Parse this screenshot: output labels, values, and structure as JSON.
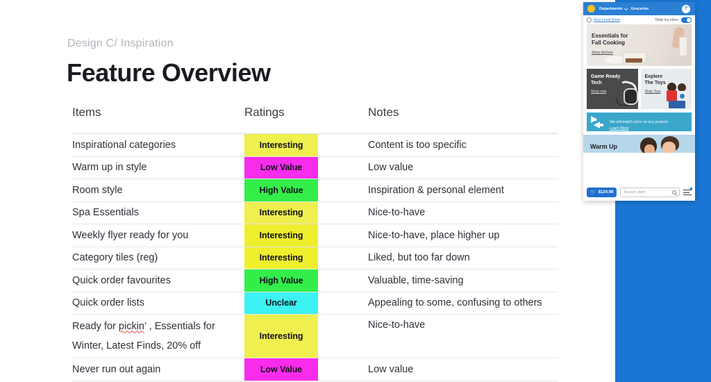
{
  "slide": {
    "eyebrow": "Design C/ Inspiration",
    "title": "Feature Overview"
  },
  "table": {
    "headers": {
      "items": "Items",
      "ratings": "Ratings",
      "notes": "Notes"
    },
    "rows": [
      {
        "item_lines": [
          "Inspirational categories"
        ],
        "rating": "Interesting",
        "rating_color": "#EFEF4F",
        "note": "Content is too specific"
      },
      {
        "item_lines": [
          "Warm up in style"
        ],
        "rating": "Low Value",
        "rating_color": "#F92CEC",
        "note": "Low value"
      },
      {
        "item_lines": [
          "Room style"
        ],
        "rating": "High Value",
        "rating_color": "#33EE4A",
        "note": "Inspiration & personal element"
      },
      {
        "item_lines": [
          "Spa Essentials"
        ],
        "rating": "Interesting",
        "rating_color": "#EFEF4F",
        "note": "Nice-to-have"
      },
      {
        "item_lines": [
          "Weekly flyer ready for you"
        ],
        "rating": "Interesting",
        "rating_color": "#EFEF2E",
        "note": "Nice-to-have, place higher up"
      },
      {
        "item_lines": [
          "Category tiles (reg)"
        ],
        "rating": "Interesting",
        "rating_color": "#EFEF2E",
        "note": "Liked, but too far down"
      },
      {
        "item_lines": [
          "Quick order favourites"
        ],
        "rating": "High Value",
        "rating_color": "#33EE4A",
        "note": "Valuable, time-saving"
      },
      {
        "item_lines": [
          "Quick order lists"
        ],
        "rating": "Unclear",
        "rating_color": "#3DF2F2",
        "note": "Appealing to some, confusing to others"
      },
      {
        "item_lines": [
          "Ready for pickin’ , Essentials for",
          "Winter, Latest Finds, 20% off"
        ],
        "misspelled_word": "pickin",
        "rating": "Interesting",
        "rating_color": "#EFEF4F",
        "note": "Nice-to-have",
        "tall": true
      },
      {
        "item_lines": [
          "Never run out again"
        ],
        "rating": "Low Value",
        "rating_color": "#F92CEC",
        "note": "Low value"
      }
    ]
  },
  "mockup": {
    "topbar": {
      "logo": "yellow-circle-logo",
      "departments": "Departments",
      "groceries": "Groceries",
      "help": "?"
    },
    "storebar": {
      "store_link": "Your Local Store",
      "shop_my_store_label": "Shop my store:",
      "toggle_state": "on"
    },
    "hero": {
      "title_line1": "Essentials for",
      "title_line2": "Fall Cooking",
      "link": "Shop Kitchen"
    },
    "tiles": [
      {
        "title_line1": "Game Ready",
        "title_line2": "Tech",
        "link": "Shop now"
      },
      {
        "title_line1": "Explore",
        "title_line2": "The Toys",
        "link": "Shop Toys"
      }
    ],
    "promo": {
      "text": "We will match price on any product.",
      "link": "Learn More"
    },
    "warm": {
      "title": "Warm Up"
    },
    "bottom": {
      "cart_amount": "$124.98",
      "search_placeholder": "Search store"
    }
  },
  "colors": {
    "panel_blue": "#1A76D2",
    "brand_blue": "#2A7FD4",
    "promo_teal": "#3AA7CB",
    "logo_yellow": "#F8C21C"
  }
}
